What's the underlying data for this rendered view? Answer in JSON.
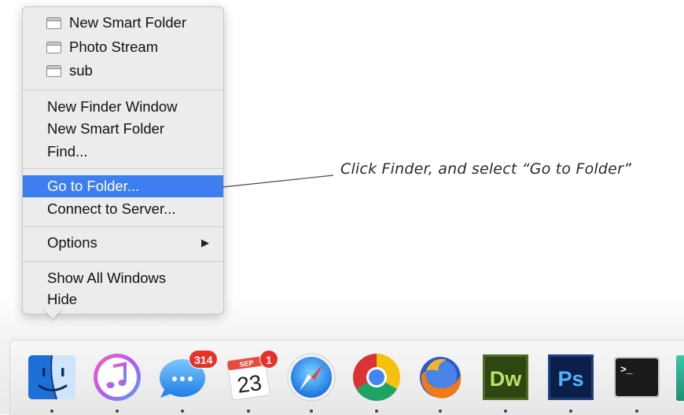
{
  "menu": {
    "windows": [
      {
        "label": "New Smart Folder"
      },
      {
        "label": "Photo Stream"
      },
      {
        "label": "sub"
      }
    ],
    "group1": [
      {
        "label": "New Finder Window"
      },
      {
        "label": "New Smart Folder"
      },
      {
        "label": "Find..."
      }
    ],
    "group2": [
      {
        "label": "Go to Folder...",
        "selected": true
      },
      {
        "label": "Connect to Server..."
      }
    ],
    "options": {
      "label": "Options",
      "arrow": "▶"
    },
    "group4": [
      {
        "label": "Show All Windows"
      },
      {
        "label": "Hide"
      }
    ]
  },
  "callout": {
    "text": "Click Finder, and select “Go to Folder”"
  },
  "dock": {
    "apps": [
      {
        "name": "finder-icon"
      },
      {
        "name": "itunes-icon"
      },
      {
        "name": "messages-icon",
        "badge": "314"
      },
      {
        "name": "calendar-icon",
        "month": "SEP",
        "day": "23",
        "badge": "1"
      },
      {
        "name": "safari-icon"
      },
      {
        "name": "chrome-icon"
      },
      {
        "name": "firefox-icon"
      },
      {
        "name": "dreamweaver-icon",
        "label": "Dw"
      },
      {
        "name": "photoshop-icon",
        "label": "Ps"
      },
      {
        "name": "terminal-icon",
        "label": ">_"
      }
    ]
  },
  "colors": {
    "selection": "#3f7ef0",
    "badge": "#e5332a"
  }
}
